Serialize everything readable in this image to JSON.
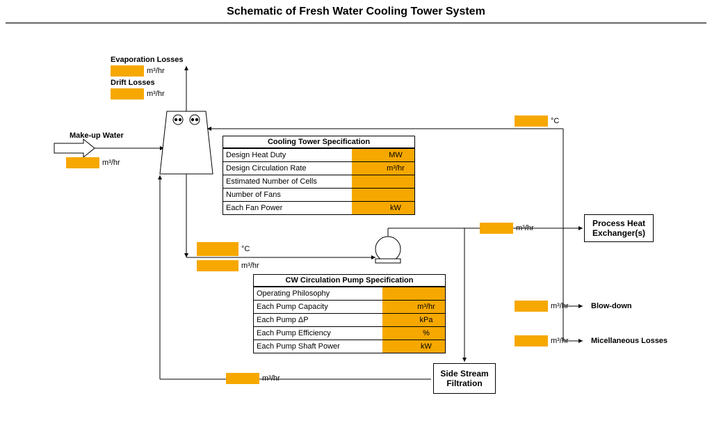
{
  "title": "Schematic of Fresh Water Cooling Tower System",
  "labels": {
    "evap_losses": "Evaporation Losses",
    "drift_losses": "Drift Losses",
    "makeup_water": "Make-up Water",
    "side_stream": "Side Stream Filtration",
    "process_hx": "Process Heat Exchanger(s)",
    "blowdown": "Blow-down",
    "misc_losses": "Micellaneous Losses"
  },
  "units": {
    "m3hr": "m³/hr",
    "degC": "°C",
    "mw": "MW",
    "kpa": "kPa",
    "pct": "%",
    "kw": "kW"
  },
  "values": {
    "evap_losses": "",
    "drift_losses": "",
    "makeup_water": "",
    "tower_out_temp": "",
    "tower_out_flow": "",
    "return_temp": "",
    "to_hx_flow": "",
    "blowdown_flow": "",
    "misc_losses_flow": "",
    "filtration_return_flow": ""
  },
  "cooling_tower_spec": {
    "title": "Cooling Tower Specification",
    "rows": [
      {
        "label": "Design Heat Duty",
        "value": "",
        "unit": "MW",
        "hasUnitFill": true
      },
      {
        "label": "Design Circulation Rate",
        "value": "",
        "unit": "m³/hr",
        "hasUnitFill": true
      },
      {
        "label": "Estimated Number of Cells",
        "value": "",
        "unit": "",
        "hasUnitFill": true
      },
      {
        "label": "Number of Fans",
        "value": "",
        "unit": "",
        "hasUnitFill": true
      },
      {
        "label": "Each Fan Power",
        "value": "",
        "unit": "kW",
        "hasUnitFill": true
      }
    ]
  },
  "cw_pump_spec": {
    "title": "CW Circulation Pump Specification",
    "rows": [
      {
        "label": "Operating Philosophy",
        "value": "",
        "unit": "",
        "hasUnitFill": true
      },
      {
        "label": "Each Pump Capacity",
        "value": "",
        "unit": "m³/hr",
        "hasUnitFill": true
      },
      {
        "label": "Each Pump ΔP",
        "value": "",
        "unit": "kPa",
        "hasUnitFill": true
      },
      {
        "label": "Each Pump Efficiency",
        "value": "",
        "unit": "%",
        "hasUnitFill": true
      },
      {
        "label": "Each Pump Shaft Power",
        "value": "",
        "unit": "kW",
        "hasUnitFill": true
      }
    ]
  }
}
